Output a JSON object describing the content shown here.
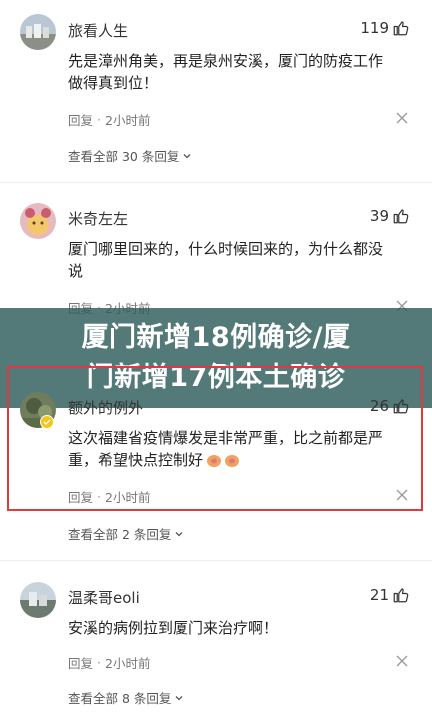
{
  "comments": [
    {
      "username": "旅看人生",
      "likes": "119",
      "text_line1": "先是漳州角美，再是泉州安溪，厦门的防疫工作",
      "text_line2": "做得真到位！",
      "reply_label": "回复",
      "time": "2小时前",
      "view_replies": "查看全部 30 条回复"
    },
    {
      "username": "米奇左左",
      "likes": "39",
      "text_line1": "厦门哪里回来的，什么时候回来的，为什么都没",
      "text_line2": "说",
      "reply_label": "回复",
      "time": "2小时前"
    },
    {
      "username": "额外的例外",
      "likes": "26",
      "text_line1": "这次福建省疫情爆发是非常严重，比之前都是严",
      "text_line2": "重，希望快点控制好",
      "reply_label": "回复",
      "time": "2小时前",
      "view_replies": "查看全部 2 条回复"
    },
    {
      "username": "温柔哥eoli",
      "likes": "21",
      "text_line1": "安溪的病例拉到厦门来治疗啊！",
      "reply_label": "回复",
      "time": "2小时前",
      "view_replies": "查看全部 8 条回复"
    }
  ],
  "banner": {
    "line1": "厦门新增18例确诊/厦",
    "line2": "门新增17例本土确诊"
  },
  "colors": {
    "banner_bg": "#2d5d5a",
    "highlight_border": "#e03a3a",
    "muted_text": "#777777"
  }
}
